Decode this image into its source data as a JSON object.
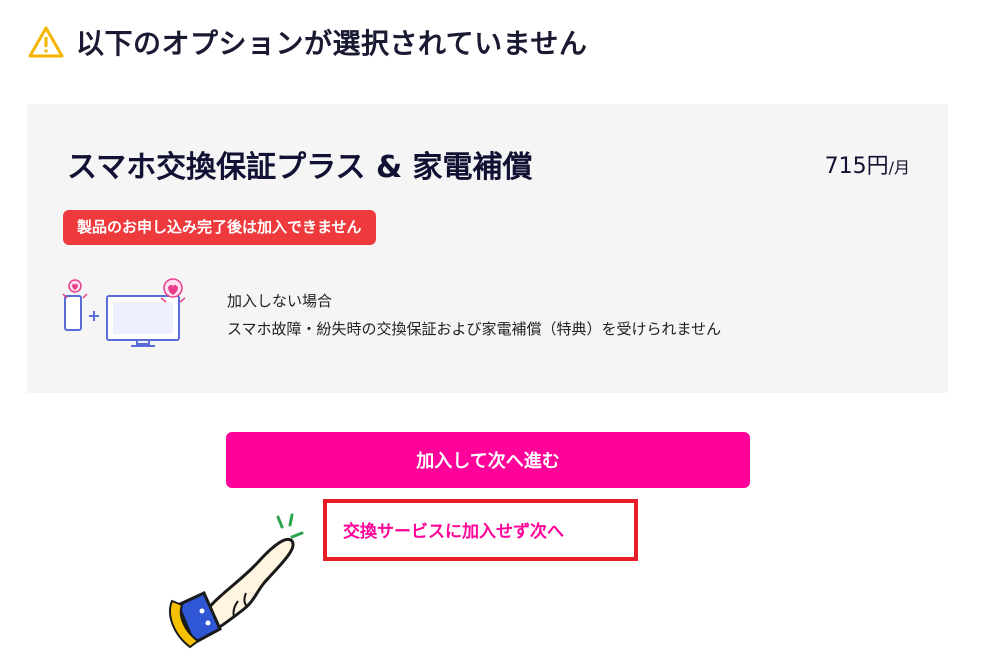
{
  "heading": {
    "title": "以下のオプションが選択されていません"
  },
  "card": {
    "plan_name": "スマホ交換保証プラス & 家電補償",
    "price": "715円",
    "price_unit": "/月",
    "badge": "製品のお申し込み完了後は加入できません",
    "note_title": "加入しない場合",
    "note_text": "スマホ故障・紛失時の交換保証および家電補償（特典）を受けられません"
  },
  "actions": {
    "primary": "加入して次へ進む",
    "skip": "交換サービスに加入せず次へ"
  },
  "colors": {
    "accent": "#ff0299",
    "badge": "#ee3a3c",
    "highlight_border": "#e81d28",
    "warning": "#f5b400"
  },
  "icons": [
    "warning-icon",
    "phone-tv-icon",
    "pointing-hand-icon"
  ]
}
